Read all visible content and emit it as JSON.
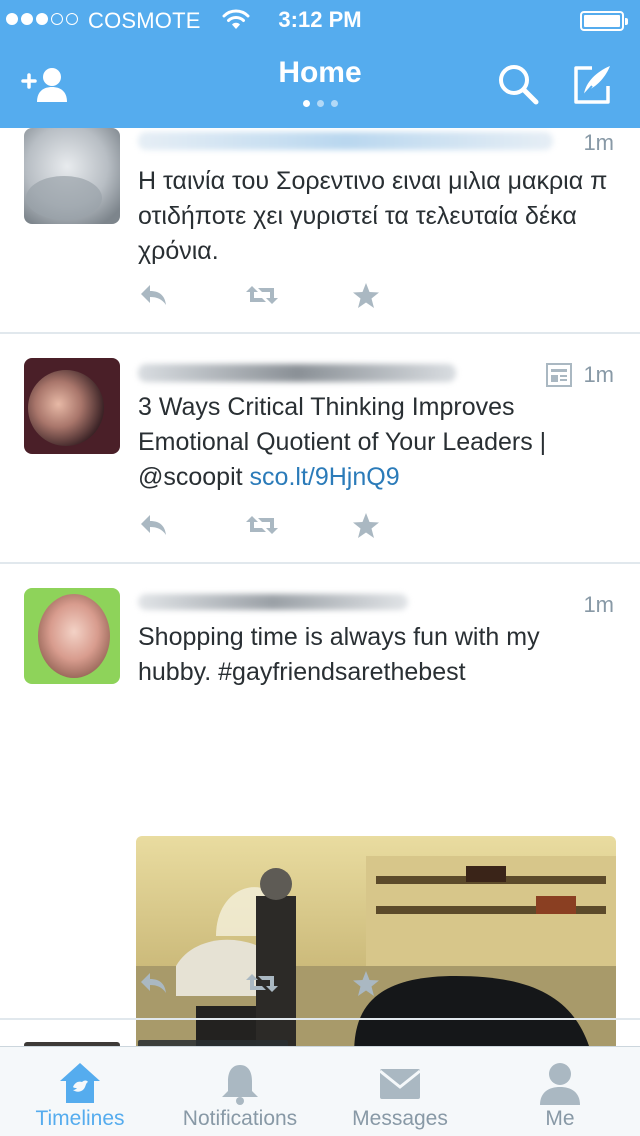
{
  "status_bar": {
    "carrier": "COSMOTE",
    "time": "3:12 PM",
    "signal_bars_filled": 3,
    "signal_bars_total": 5
  },
  "nav": {
    "title": "Home",
    "left_icon": "add-user-icon",
    "right_icons": [
      "search-icon",
      "compose-icon"
    ],
    "page_count": 3,
    "active_page": 1
  },
  "tweets": [
    {
      "time": "1m",
      "text": "Η ταινία του Σορεντινο ειναι μιλια μακρια π οτιδήποτε χει γυριστεί τα τελευταία δέκα χρόνια.",
      "has_summary_icon": false
    },
    {
      "time": "1m",
      "text_parts": [
        "3 Ways Critical Thinking Improves Emotional Quotient of Your Leaders | @scoopit ",
        "sco.lt/9HjnQ9"
      ],
      "has_summary_icon": true
    },
    {
      "time": "1m",
      "text": "Shopping time is always fun with my hubby. #gayfriendsarethebest",
      "has_media": true
    }
  ],
  "tabbar": {
    "items": [
      {
        "label": "Timelines",
        "icon": "home-icon",
        "active": true
      },
      {
        "label": "Notifications",
        "icon": "bell-icon",
        "active": false
      },
      {
        "label": "Messages",
        "icon": "envelope-icon",
        "active": false
      },
      {
        "label": "Me",
        "icon": "person-icon",
        "active": false
      }
    ]
  },
  "colors": {
    "brand": "#55acee",
    "icon_gray": "#aab8c2",
    "link": "#2b7bb9",
    "meta_text": "#8899a6"
  }
}
